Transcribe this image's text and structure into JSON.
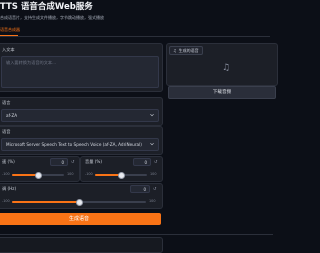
{
  "header": {
    "title": "TTS 语音合成Web服务",
    "subtitle": "合成语音片，支持生成文件播放，字节跳动播放，强式播放"
  },
  "tabs": [
    {
      "label": "语音合成器"
    }
  ],
  "text_input": {
    "label": "入文本",
    "placeholder": "输入要转换为语音的文本..."
  },
  "language": {
    "label": "语言",
    "value": "af-ZA"
  },
  "voice": {
    "label": "语音",
    "value": "Microsoft Server Speech Text to Speech Voice (af-ZA, AdriNeural)"
  },
  "rate": {
    "label": "速 (%)",
    "value": "0",
    "min": "-100",
    "max": "100",
    "fraction": 0.5
  },
  "volume": {
    "label": "音量 (%)",
    "value": "0",
    "min": "-100",
    "max": "100",
    "fraction": 0.5
  },
  "pitch": {
    "label": "调 (Hz)",
    "value": "0",
    "min": "-100",
    "max": "100",
    "fraction": 0.5
  },
  "generate_button": {
    "label": "生成语音"
  },
  "output_audio": {
    "label": "生成的语音"
  },
  "download_button": {
    "label": "下载音频"
  },
  "reset_glyph": "↺",
  "music_glyph": "♫",
  "colors": {
    "accent": "#f97316",
    "background": "#0c0f17",
    "panel": "#1c1f27"
  }
}
